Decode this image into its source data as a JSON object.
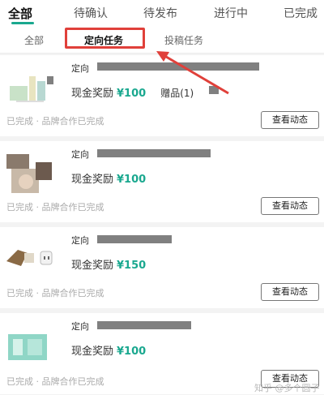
{
  "status_tabs": [
    {
      "label": "全部",
      "active": true
    },
    {
      "label": "待确认",
      "active": false
    },
    {
      "label": "待发布",
      "active": false
    },
    {
      "label": "进行中",
      "active": false
    },
    {
      "label": "已完成",
      "active": false
    }
  ],
  "sub_tabs": [
    {
      "label": "全部",
      "active": false
    },
    {
      "label": "定向任务",
      "active": true
    },
    {
      "label": "投稿任务",
      "active": false
    }
  ],
  "tasks": [
    {
      "type_label": "定向",
      "reward_label": "现金奖励",
      "reward_amount": "¥100",
      "gift": "赠品(1)",
      "footer": "已完成 · 品牌合作已完成",
      "button": "查看动态"
    },
    {
      "type_label": "定向",
      "reward_label": "现金奖励",
      "reward_amount": "¥100",
      "gift": "",
      "footer": "已完成 · 品牌合作已完成",
      "button": "查看动态"
    },
    {
      "type_label": "定向",
      "reward_label": "现金奖励",
      "reward_amount": "¥150",
      "gift": "",
      "footer": "已完成 · 品牌合作已完成",
      "button": "查看动态"
    },
    {
      "type_label": "定向",
      "reward_label": "现金奖励",
      "reward_amount": "¥100",
      "gift": "",
      "footer": "已完成 · 品牌合作已完成",
      "button": "查看动态"
    }
  ],
  "watermark": "知乎 @多个圆子",
  "colors": {
    "accent": "#1aa88f",
    "annotation": "#e0403a",
    "background": "#f3f3f3"
  }
}
